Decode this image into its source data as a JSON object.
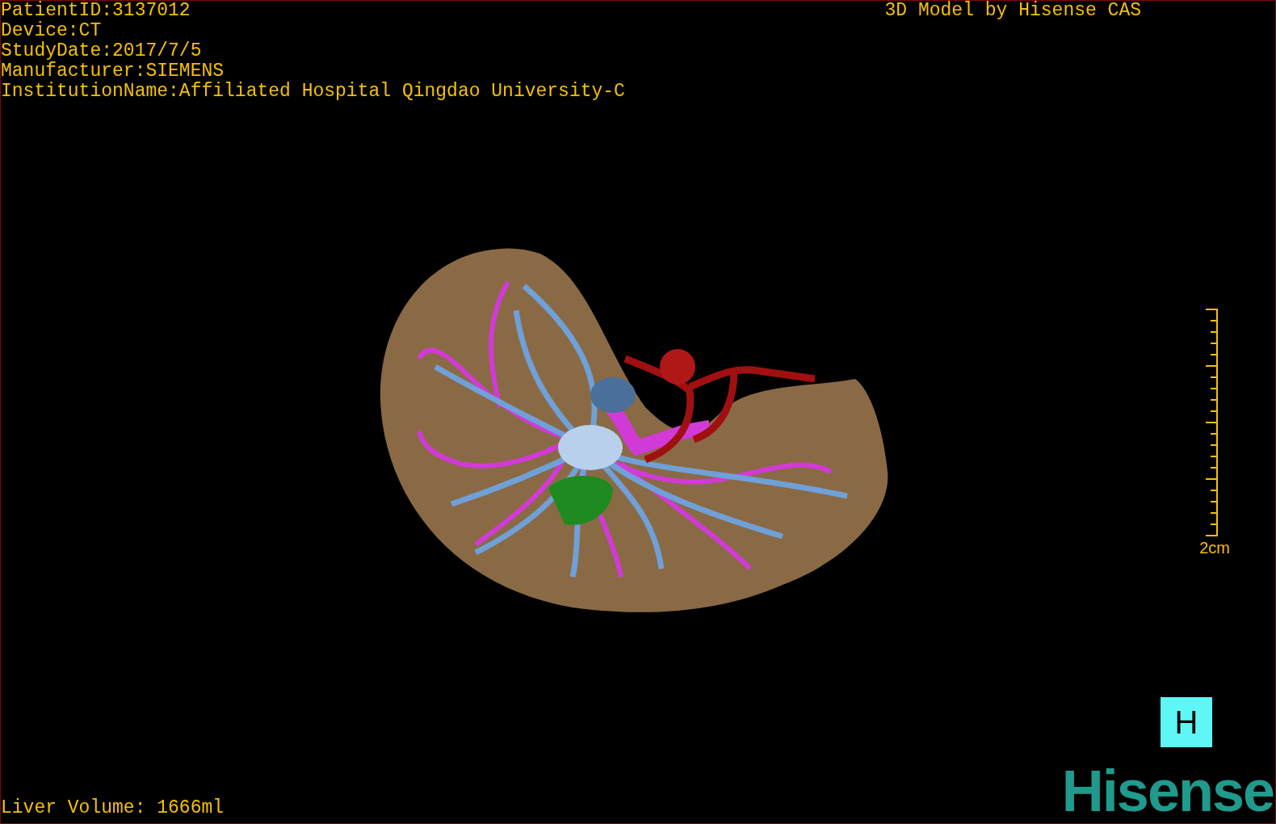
{
  "patient_info": [
    "PatientID:3137012",
    "Device:CT",
    "StudyDate:2017/7/5",
    "Manufacturer:SIEMENS",
    "InstitutionName:Affiliated Hospital Qingdao University-C"
  ],
  "title": "3D Model by Hisense CAS",
  "scale_bar": {
    "label": "2cm"
  },
  "liver_volume": "Liver Volume: 1666ml",
  "orientation_button": "H",
  "logo": "Hisense"
}
